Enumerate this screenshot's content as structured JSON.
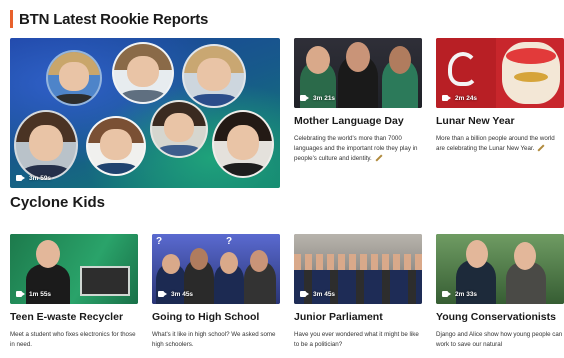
{
  "colors": {
    "accent": "#e8612c"
  },
  "section": {
    "title": "BTN Latest Rookie Reports"
  },
  "hero": {
    "duration": "3m 59s",
    "icon": "video-camera-icon"
  },
  "cards_top": [
    {
      "duration": "3m 21s",
      "title": "Mother Language Day",
      "description": "Celebrating the world's more than 7000 languages and the important role they play in people's culture and identity."
    },
    {
      "duration": "2m 24s",
      "title": "Lunar New Year",
      "description": "More than a billion people around the world are celebrating the Lunar New Year."
    }
  ],
  "cyclone_heading": "Cyclone Kids",
  "cards_bottom": [
    {
      "duration": "1m 55s",
      "title": "Teen E-waste Recycler",
      "description": "Meet a student who fixes electronics for those in need."
    },
    {
      "duration": "3m 45s",
      "title": "Going to High School",
      "description": "What's it like in high school? We asked some high schoolers."
    },
    {
      "duration": "3m 45s",
      "title": "Junior Parliament",
      "description": "Have you ever wondered what it might be like to be a politician?"
    },
    {
      "duration": "2m 33s",
      "title": "Young Conservationists",
      "description": "Django and Alice show how young people can work to save our natural"
    }
  ]
}
